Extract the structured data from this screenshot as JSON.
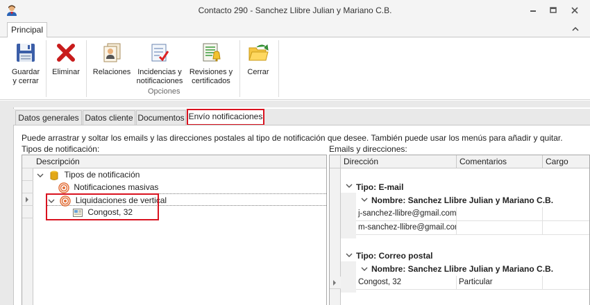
{
  "window": {
    "title": "Contacto 290 - Sanchez Llibre Julian y Mariano C.B."
  },
  "ribbon": {
    "tab": "Principal",
    "buttons": {
      "guardar": [
        "Guardar",
        "y cerrar"
      ],
      "eliminar": "Eliminar",
      "relaciones": "Relaciones",
      "incidencias": [
        "Incidencias y",
        "notificaciones"
      ],
      "revisiones": [
        "Revisiones y",
        "certificados"
      ],
      "cerrar": "Cerrar"
    },
    "group_label": "Opciones"
  },
  "tabs": [
    "Datos generales",
    "Datos cliente",
    "Documentos",
    "Envío notificaciones"
  ],
  "active_tab": "Envío notificaciones",
  "hint": "Puede arrastrar y soltar los emails y las direcciones postales al tipo de notificación que desee. También puede usar los menús para añadir y quitar.",
  "left_panel": {
    "label": "Tipos de notificación:",
    "header": "Descripción",
    "rows": {
      "root": "Tipos de notificación",
      "masivas": "Notificaciones masivas",
      "liquidaciones": "Liquidaciones de vertical",
      "congost": "Congost, 32"
    }
  },
  "right_panel": {
    "label": "Emails y direcciones:",
    "headers": [
      "Dirección",
      "Comentarios",
      "Cargo"
    ],
    "email_group": "Tipo: E-mail",
    "email_name": "Nombre: Sanchez Llibre Julian y Mariano C.B.",
    "emails": [
      "j-sanchez-llibre@gmail.com",
      "m-sanchez-llibre@gmail.com"
    ],
    "postal_group": "Tipo: Correo postal",
    "postal_name": "Nombre: Sanchez Llibre Julian y Mariano C.B.",
    "postal_rows": [
      {
        "direccion": "Congost, 32",
        "comentarios": "Particular",
        "cargo": ""
      }
    ]
  },
  "colors": {
    "highlight": "#d9121f"
  }
}
